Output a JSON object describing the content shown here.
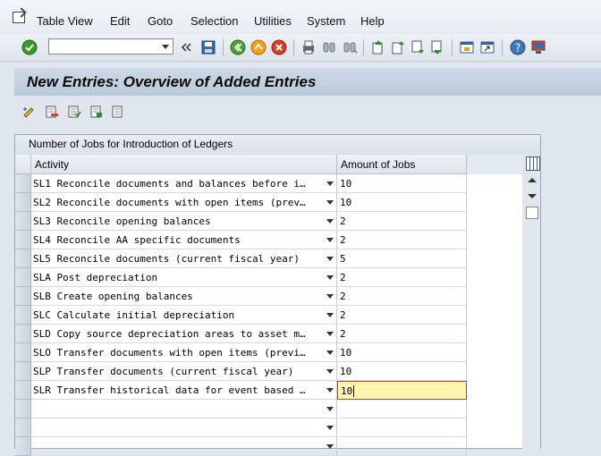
{
  "menu": {
    "items": [
      "Table View",
      "Edit",
      "Goto",
      "Selection",
      "Utilities",
      "System",
      "Help"
    ]
  },
  "toolbar": {
    "command_field_value": "",
    "icons": [
      "enter-check-icon",
      "save-icon",
      "back-icon",
      "exit-icon",
      "cancel-icon",
      "print-icon",
      "find-icon",
      "find-next-icon",
      "first-page-icon",
      "previous-page-icon",
      "next-page-icon",
      "last-page-icon",
      "create-session-icon",
      "shortcut-icon",
      "help-icon",
      "customize-layout-icon"
    ]
  },
  "page": {
    "title": "New Entries: Overview of Added Entries"
  },
  "app_toolbar": {
    "icons": [
      "display-change-icon",
      "delete-icon",
      "select-all-icon",
      "select-block-icon",
      "deselect-all-icon"
    ]
  },
  "table": {
    "title": "Number of Jobs for Introduction of Ledgers",
    "columns": [
      "Activity",
      "Amount of Jobs"
    ],
    "rows": [
      {
        "activity": "SL1 Reconcile documents and balances before i…",
        "amount": "10"
      },
      {
        "activity": "SL2 Reconcile documents with open items (prev…",
        "amount": "10"
      },
      {
        "activity": "SL3 Reconcile opening balances",
        "amount": "2"
      },
      {
        "activity": "SL4 Reconcile AA specific documents",
        "amount": "2"
      },
      {
        "activity": "SL5 Reconcile documents (current fiscal year)",
        "amount": "5"
      },
      {
        "activity": "SLA Post depreciation",
        "amount": "2"
      },
      {
        "activity": "SLB Create opening balances",
        "amount": "2"
      },
      {
        "activity": "SLC Calculate initial depreciation",
        "amount": "2"
      },
      {
        "activity": "SLD Copy source depreciation areas to asset m…",
        "amount": "2"
      },
      {
        "activity": "SLO Transfer documents with open items (previ…",
        "amount": "10"
      },
      {
        "activity": "SLP Transfer documents (current fiscal year)",
        "amount": "10"
      },
      {
        "activity": "SLR Transfer historical data for event based …",
        "amount": "10"
      },
      {
        "activity": "",
        "amount": ""
      },
      {
        "activity": "",
        "amount": ""
      },
      {
        "activity": "",
        "amount": ""
      }
    ],
    "focused_row": 11
  },
  "colors": {
    "title_bar": "#c3d2e2",
    "focus_fill": "#fff4b0",
    "focus_border": "#c2412b",
    "ok_green": "#3a9a2a"
  }
}
